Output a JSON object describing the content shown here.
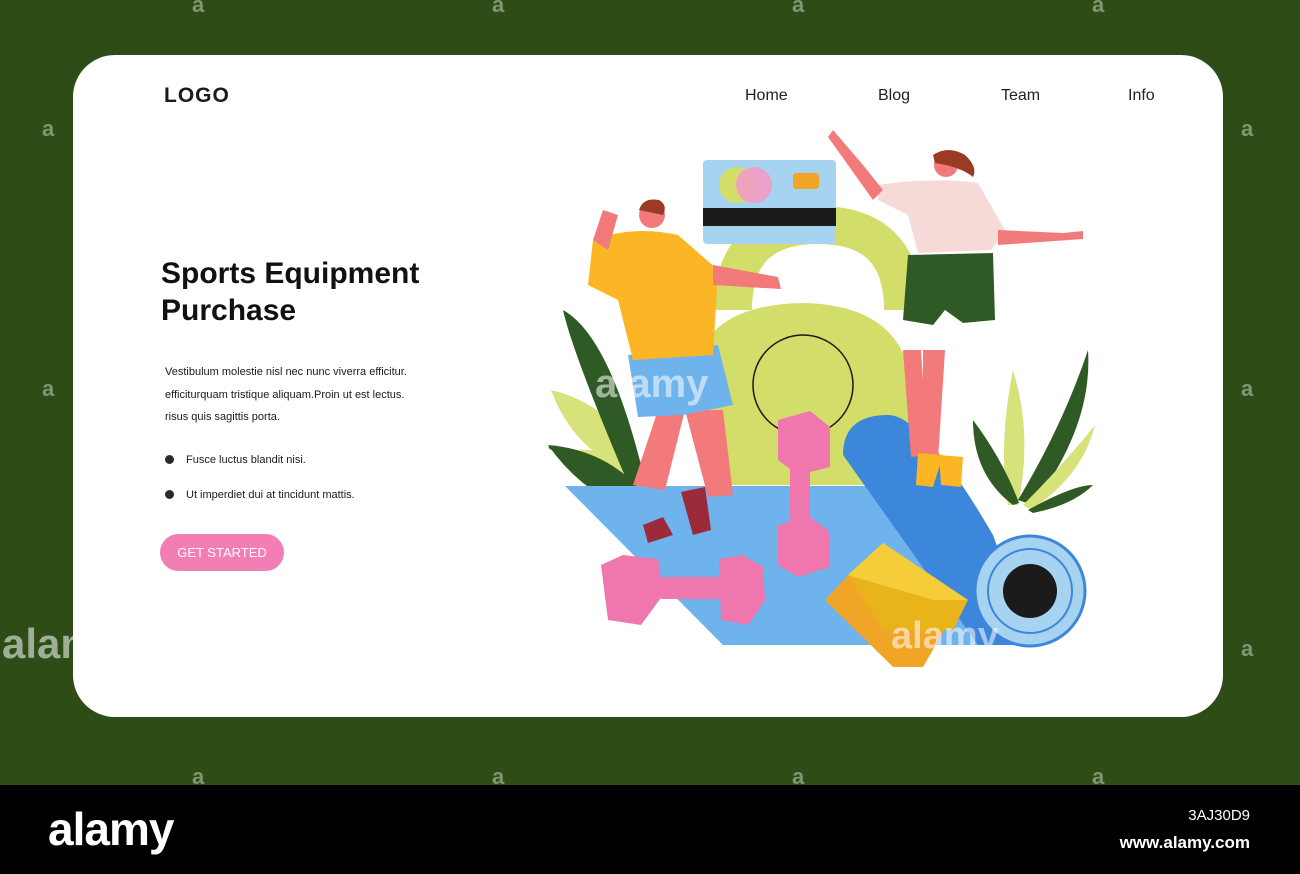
{
  "header": {
    "logo": "LOGO",
    "nav": [
      "Home",
      "Blog",
      "Team",
      "Info"
    ]
  },
  "hero": {
    "title": "Sports Equipment Purchase",
    "description": [
      "Vestibulum molestie nisl nec nunc viverra efficitur.",
      "efficiturquam tristique aliquam.Proin ut est lectus.",
      "risus quis sagittis porta."
    ],
    "bullets": [
      "Fusce luctus blandit nisi.",
      "Ut imperdiet dui at tincidunt mattis."
    ],
    "cta_label": "GET STARTED"
  },
  "illustration": {
    "items": [
      "person-man-icon",
      "person-woman-icon",
      "credit-card-icon",
      "kettlebell-icon",
      "dumbbell-icon",
      "yoga-mat-icon",
      "yoga-block-icon",
      "leaf-icon"
    ]
  },
  "stock": {
    "brand": "alamy",
    "image_id": "3AJ30D9",
    "site": "www.alamy.com",
    "background_mark": "a"
  },
  "colors": {
    "background": "#2d4c16",
    "card": "#ffffff",
    "accent_pink": "#f37db5",
    "mat_blue": "#3c8fe0",
    "kettlebell_green": "#d2dd6a",
    "block_orange": "#f0a526"
  }
}
